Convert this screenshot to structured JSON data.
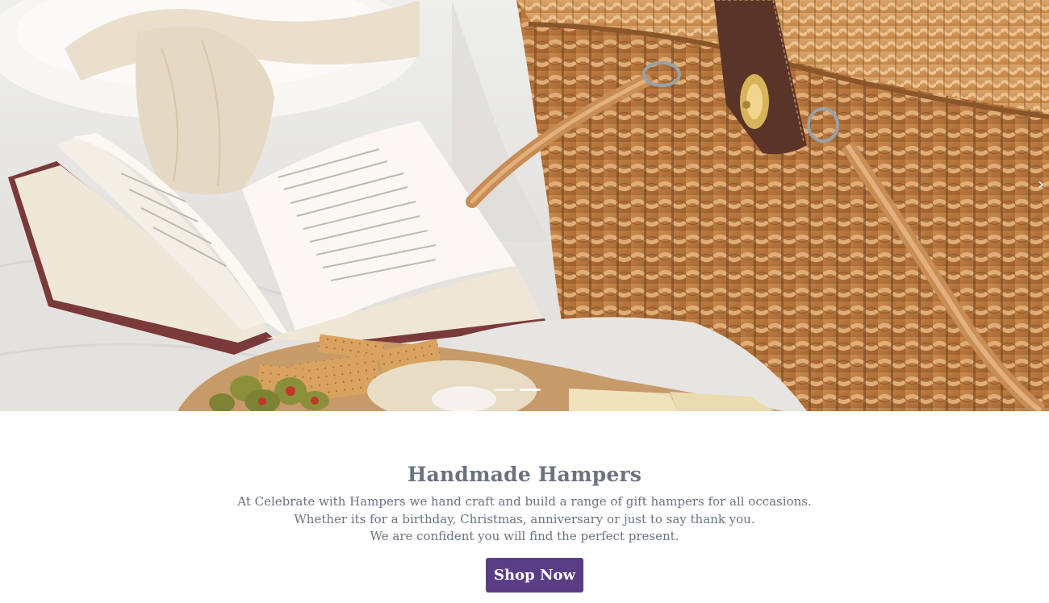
{
  "hero": {
    "image_alt": "Picnic scene with an open book, a wicker picnic basket and a board of crackers, olives and cheese",
    "next_icon": "chevron-right-icon",
    "next_glyph": "›",
    "dots": [
      {
        "active": false
      },
      {
        "active": true
      }
    ]
  },
  "intro": {
    "title": "Handmade Hampers",
    "lines": [
      "At Celebrate with Hampers we hand craft and build a range of gift hampers for all occasions.",
      "Whether its for a birthday, Christmas, anniversary or just to say thank you.",
      "We are confident you will find the perfect present."
    ],
    "button_label": "Shop Now"
  },
  "colors": {
    "accent": "#5a3e85",
    "text": "#6b7280",
    "background": "#ffffff"
  }
}
